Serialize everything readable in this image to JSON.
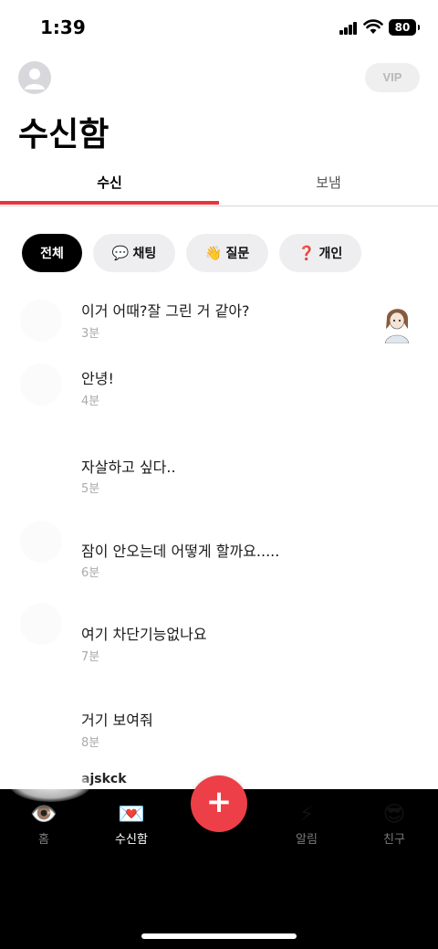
{
  "status": {
    "time": "1:39",
    "battery": "80"
  },
  "header": {
    "vip_label": "VIP",
    "title": "수신함"
  },
  "tabs": [
    {
      "label": "수신"
    },
    {
      "label": "보냄"
    }
  ],
  "filters": [
    {
      "label": "전체",
      "icon": ""
    },
    {
      "label": "채팅",
      "icon": "💬"
    },
    {
      "label": "질문",
      "icon": "👋"
    },
    {
      "label": "개인",
      "icon": "❓"
    }
  ],
  "messages": [
    {
      "text": "이거 어때?잘 그린 거 같아?",
      "time": "3분"
    },
    {
      "text": "안녕!",
      "time": "4분"
    },
    {
      "text": "자살하고 싶다..",
      "time": "5분"
    },
    {
      "text": "잠이 안오는데 어떻게 할까요.....",
      "time": "6분"
    },
    {
      "text": "여기 차단기능없나요",
      "time": "7분"
    },
    {
      "text": "거기 보여줘",
      "time": "8분"
    }
  ],
  "partial_sender": "ajskck",
  "tabbar": {
    "items": [
      {
        "label": "홈",
        "icon": "👁️"
      },
      {
        "label": "수신함",
        "icon": "💌"
      },
      {
        "label": "알림",
        "icon": "⚡"
      },
      {
        "label": "친구",
        "icon": "😎"
      }
    ],
    "fab": "+"
  },
  "colors": {
    "accent": "#e4363f",
    "fab": "#ed3f47"
  }
}
